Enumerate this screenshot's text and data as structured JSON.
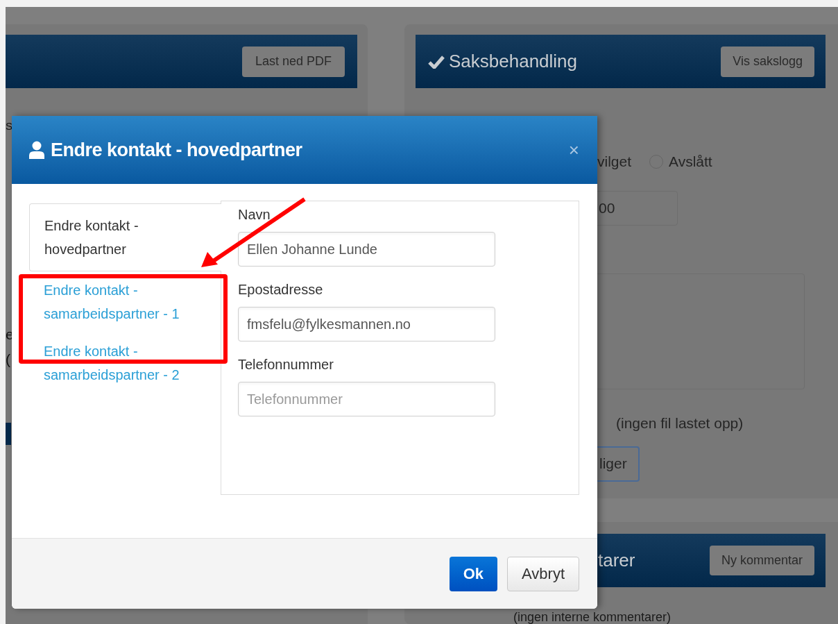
{
  "background": {
    "left_panel": {
      "button": "Last ned PDF",
      "fragments": [
        "S",
        "e",
        "("
      ]
    },
    "right_panel": {
      "title": "Saksbehandling",
      "button": "Vis sakslogg",
      "partial_option": "vilget",
      "radio": {
        "label": "Avslått",
        "checked": false
      },
      "amount_value": "00",
      "file_note": "(ingen fil lastet opp)",
      "action_button": "liger"
    },
    "comments_panel": {
      "title": "tarer",
      "button": "Ny kommentar",
      "empty_text": "(ingen interne kommentarer)"
    }
  },
  "dialog": {
    "title": "Endre kontakt - hovedpartner",
    "close": "×",
    "tabs": [
      {
        "label": "Endre kontakt - hovedpartner",
        "selected": true
      },
      {
        "label": "Endre kontakt - samarbeidspartner - 1",
        "selected": false
      },
      {
        "label": "Endre kontakt - samarbeidspartner - 2",
        "selected": false
      }
    ],
    "fields": [
      {
        "label": "Navn",
        "value": "Ellen Johanne Lunde"
      },
      {
        "label": "Epostadresse",
        "value": "fmsfelu@fylkesmannen.no"
      },
      {
        "label": "Telefonnummer",
        "placeholder": "Telefonnummer"
      }
    ],
    "buttons": [
      {
        "label": "Ok",
        "kind": "primary"
      },
      {
        "label": "Avbryt",
        "kind": "default"
      }
    ]
  }
}
